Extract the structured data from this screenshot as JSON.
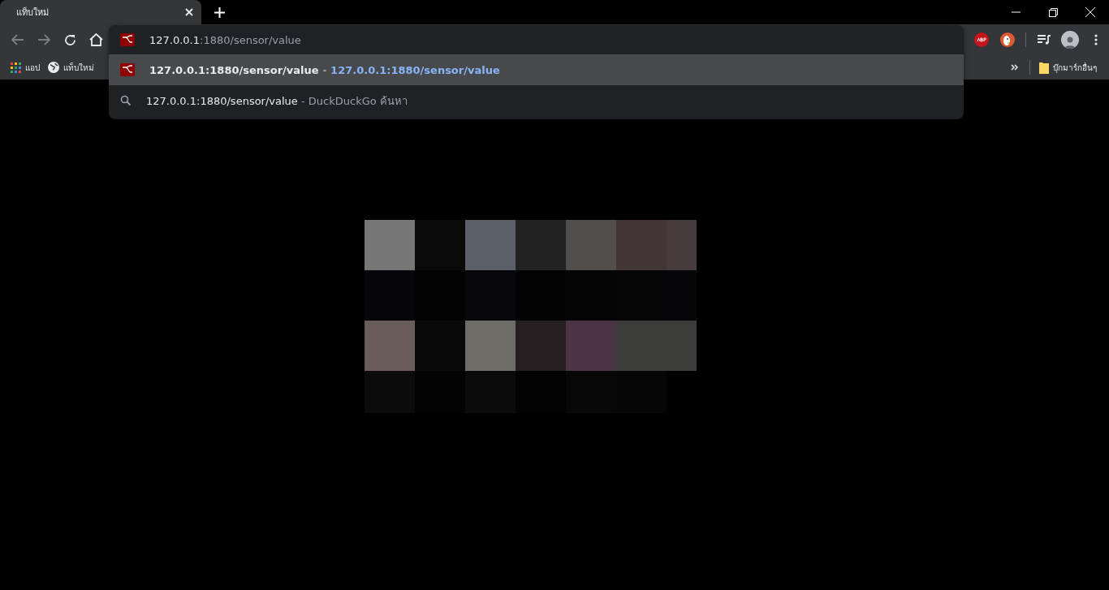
{
  "tabs": [
    {
      "title": "แท็บใหม่",
      "selected": true
    }
  ],
  "omnibox": {
    "host": "127.0.0.1",
    "path": ":1880/sensor/value"
  },
  "suggestion_separator": "-",
  "suggestions": [
    {
      "kind": "url",
      "selected": true,
      "text": "127.0.0.1:1880/sensor/value",
      "description": "127.0.0.1:1880/sensor/value"
    },
    {
      "kind": "search",
      "selected": false,
      "text": "127.0.0.1:1880/sensor/value",
      "description": "DuckDuckGo ค้นหา"
    }
  ],
  "bookmarks": [
    {
      "kind": "apps",
      "label": "แอป"
    },
    {
      "kind": "site",
      "label": "แท็บใหม่"
    }
  ],
  "other_bookmarks": "บุ๊กมาร์กอื่นๆ"
}
